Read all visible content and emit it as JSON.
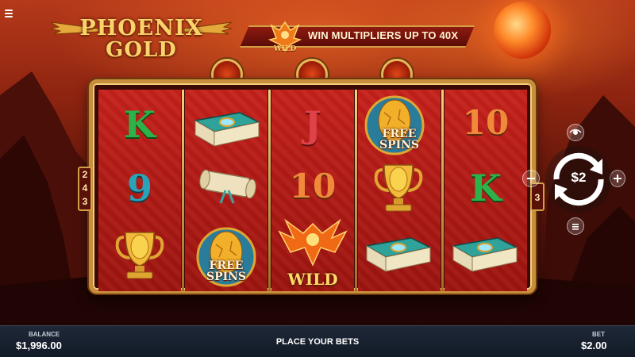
{
  "game": {
    "logo_line1": "PHOENIX",
    "logo_line2": "GOLD",
    "banner_text": "WIN MULTIPLIERS UP TO 40X",
    "banner_emblem_label": "WILD"
  },
  "reels": [
    {
      "symbols": [
        {
          "type": "letter",
          "text": "K",
          "color": "#2fb14a"
        },
        {
          "type": "letter",
          "text": "9",
          "color": "#2aa3b8"
        },
        {
          "type": "icon",
          "icon": "golden-egg-trophy-icon"
        }
      ]
    },
    {
      "symbols": [
        {
          "type": "icon",
          "icon": "teal-book-icon"
        },
        {
          "type": "icon",
          "icon": "scroll-icon"
        },
        {
          "type": "free",
          "icon": "golden-egg-icon",
          "label_line1": "FREE",
          "label_line2": "SPINS"
        }
      ]
    },
    {
      "symbols": [
        {
          "type": "letter",
          "text": "J",
          "color": "#e0424a"
        },
        {
          "type": "letter",
          "text": "10",
          "color": "#f0893a"
        },
        {
          "type": "wild",
          "icon": "phoenix-icon",
          "label": "WILD"
        }
      ]
    },
    {
      "symbols": [
        {
          "type": "free",
          "icon": "golden-egg-icon",
          "label_line1": "FREE",
          "label_line2": "SPINS"
        },
        {
          "type": "icon",
          "icon": "golden-egg-trophy-icon"
        },
        {
          "type": "icon",
          "icon": "teal-book-icon"
        }
      ]
    },
    {
      "symbols": [
        {
          "type": "letter",
          "text": "10",
          "color": "#f0893a"
        },
        {
          "type": "letter",
          "text": "K",
          "color": "#2fb14a"
        },
        {
          "type": "icon",
          "icon": "teal-book-icon"
        }
      ]
    }
  ],
  "ways_left": [
    "2",
    "4",
    "3"
  ],
  "ways_right": [
    "3"
  ],
  "controls": {
    "spin_value": "$2"
  },
  "footer": {
    "balance_label": "BALANCE",
    "balance_value": "$1,996.00",
    "center_message": "PLACE YOUR BETS",
    "bet_label": "BET",
    "bet_value": "$2.00"
  },
  "colors": {
    "gold": "#d2a046",
    "reel_red": "#b01a15",
    "footer_bg": "#121a26"
  }
}
